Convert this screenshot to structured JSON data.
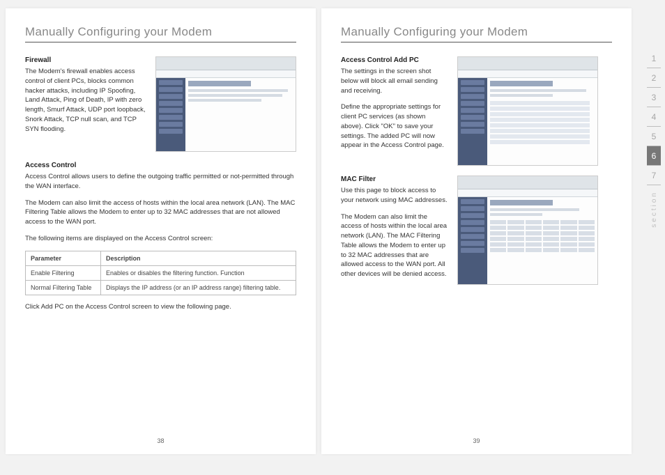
{
  "left": {
    "title": "Manually Configuring your Modem",
    "firewall": {
      "head": "Firewall",
      "body": "The Modem's firewall enables access control of client PCs, blocks common hacker attacks, including IP Spoofing, Land Attack, Ping of Death, IP with zero length, Smurf Attack, UDP port loopback, Snork Attack, TCP null scan, and TCP SYN flooding."
    },
    "access_control": {
      "head": "Access Control",
      "p1": "Access Control allows users to define the outgoing traffic permitted or not-permitted through the WAN interface.",
      "p2": "The Modem can also limit the access of hosts within the local area network (LAN). The MAC Filtering Table allows the Modem to enter up to 32 MAC addresses that are not allowed access to the WAN port.",
      "p3": "The following items are displayed on the Access Control screen:",
      "table": {
        "h1": "Parameter",
        "h2": "Description",
        "r1c1": "Enable Filtering",
        "r1c2": "Enables or disables the filtering function. Function",
        "r2c1": "Normal Filtering Table",
        "r2c2": "Displays the IP address (or an IP address range) filtering table."
      },
      "after": "Click Add PC on the Access Control screen to view the following page."
    },
    "page_number": "38"
  },
  "right": {
    "title": "Manually Configuring your Modem",
    "addpc": {
      "head": "Access Control Add PC",
      "p1": "The settings in the screen shot below will block all email sending and receiving.",
      "p2": "Define the appropriate settings for client PC services (as shown above). Click \"OK\" to save your settings. The added PC will now appear in the Access Control page."
    },
    "macfilter": {
      "head": "MAC Filter",
      "p1": "Use this page to block access to your network using MAC addresses.",
      "p2": "The Modem can also limit the access of hosts within the local area network (LAN). The MAC Filtering Table allows the Modem to enter up to 32 MAC addresses that are allowed access to the WAN port. All other devices will be denied access."
    },
    "page_number": "39"
  },
  "nav": {
    "items": [
      "1",
      "2",
      "3",
      "4",
      "5",
      "6",
      "7"
    ],
    "active_index": 5,
    "label": "section"
  }
}
